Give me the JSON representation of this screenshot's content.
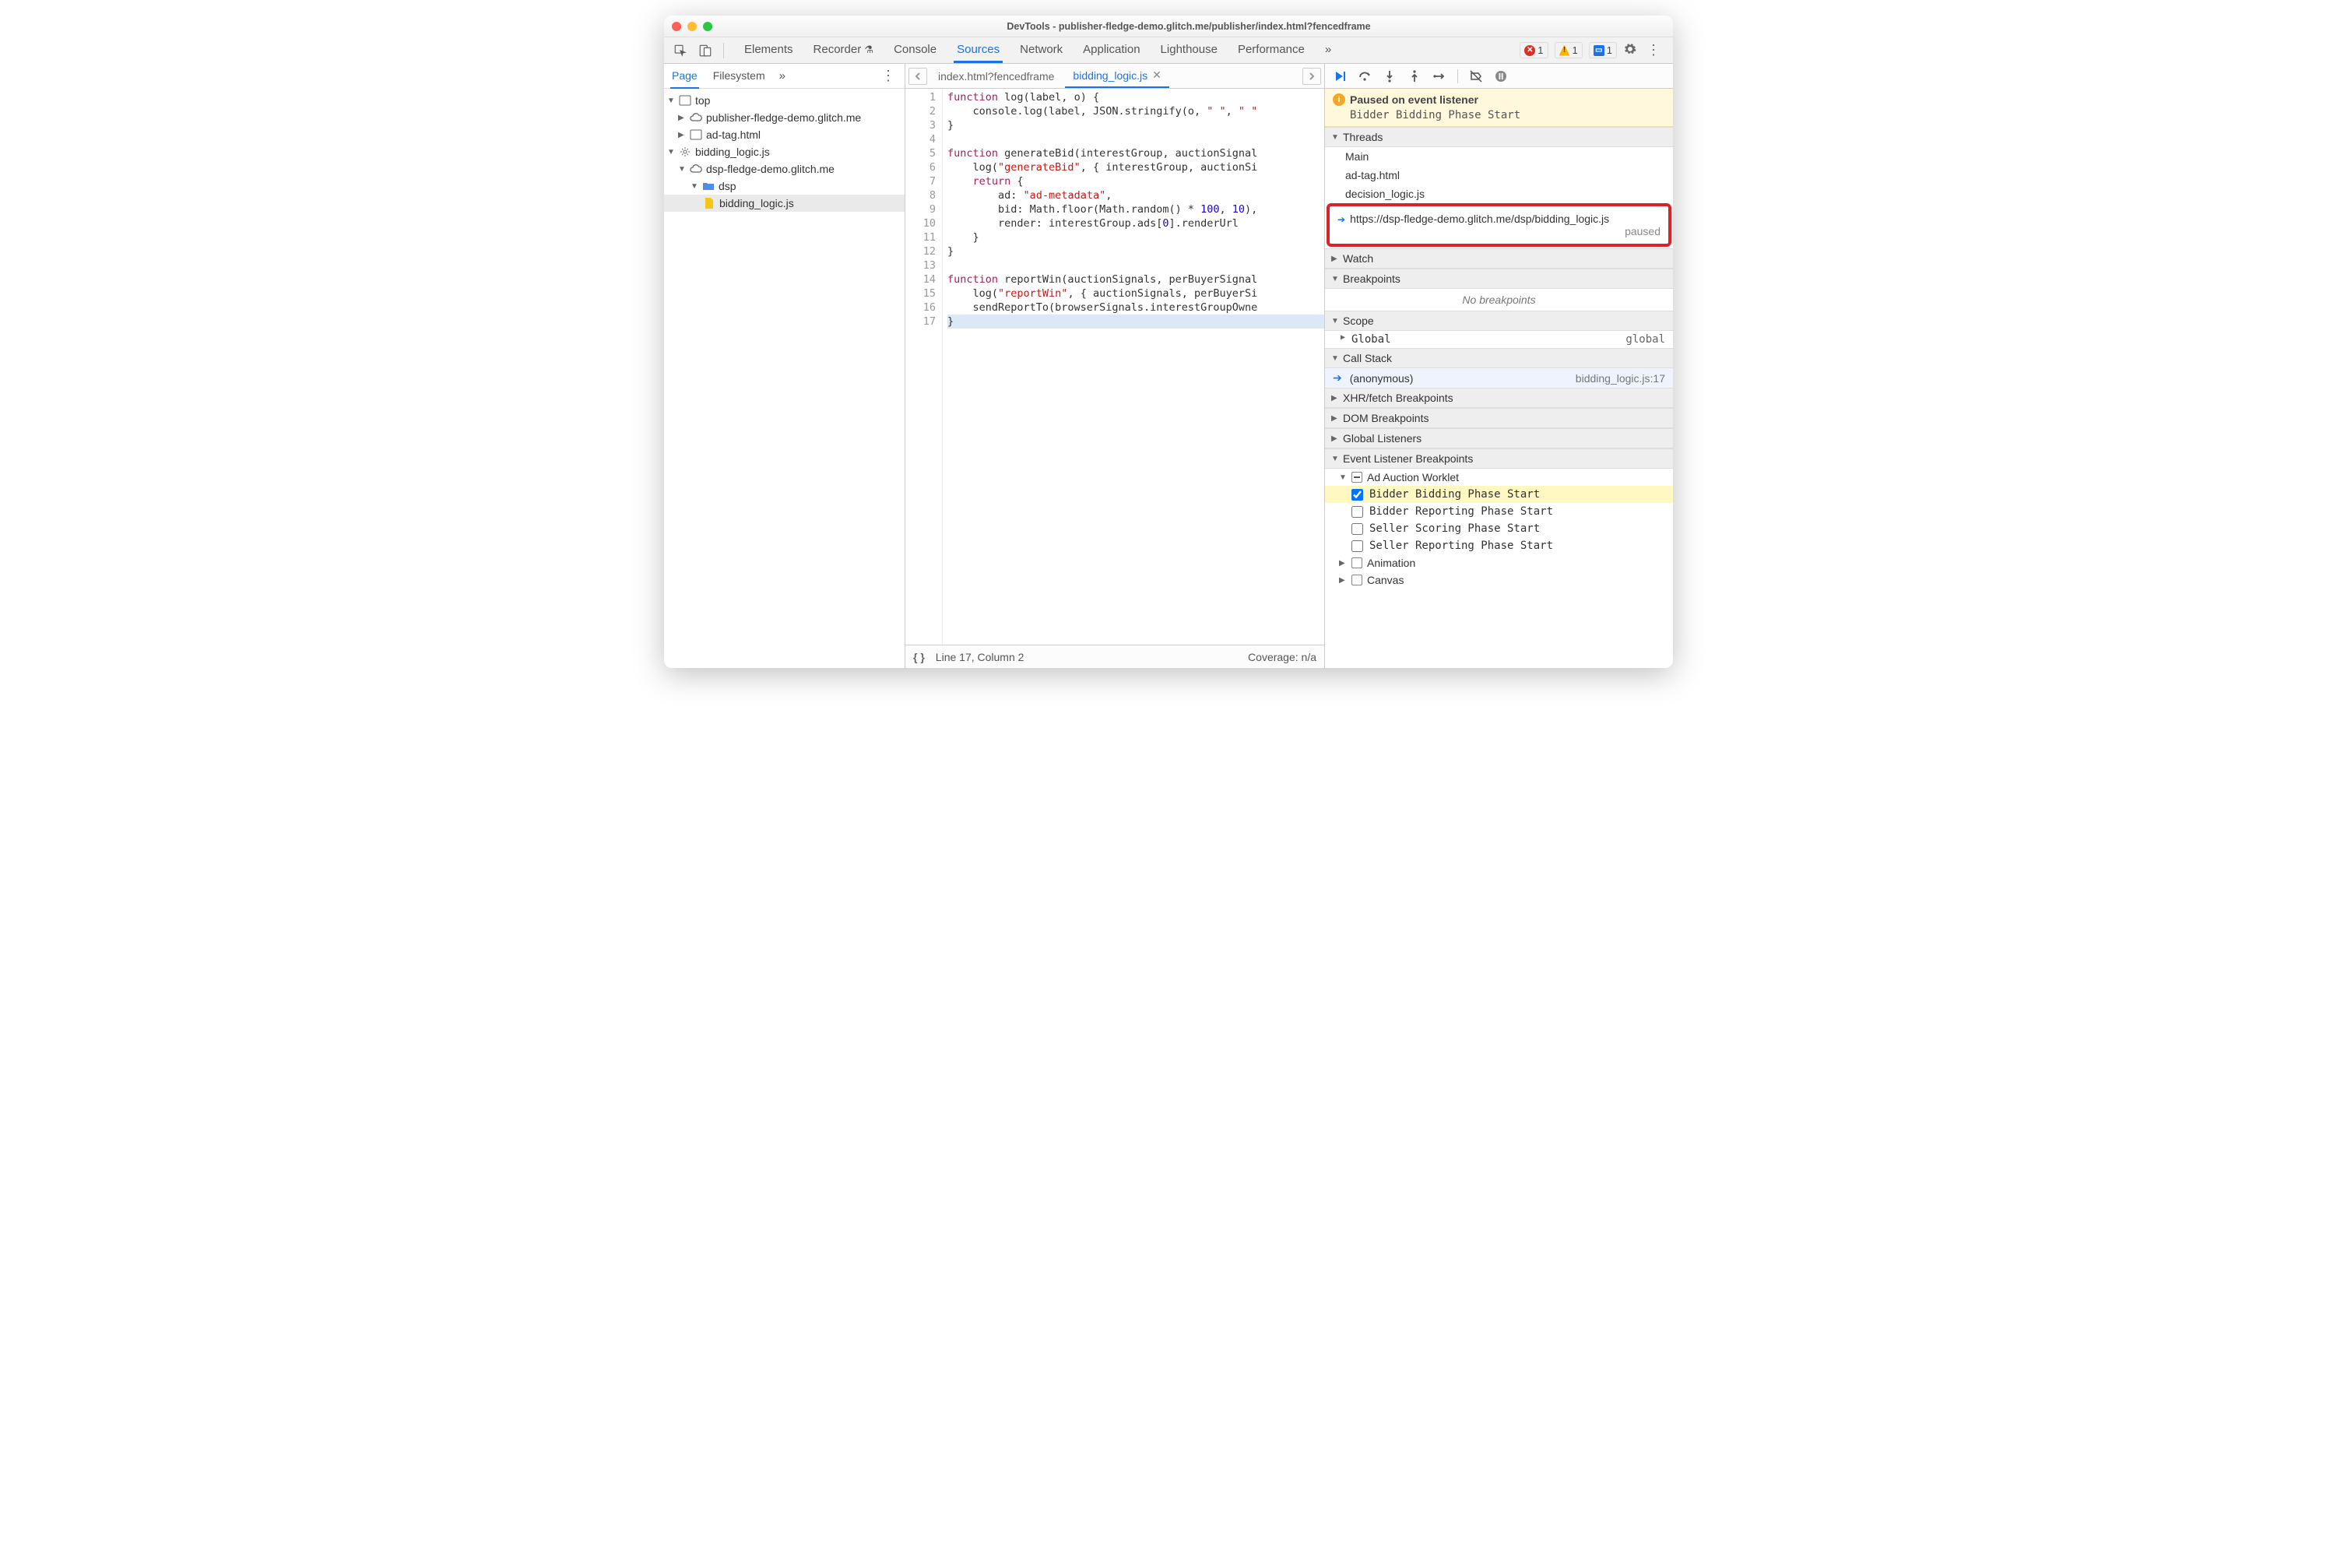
{
  "window_title": "DevTools - publisher-fledge-demo.glitch.me/publisher/index.html?fencedframe",
  "main_tabs": [
    "Elements",
    "Recorder",
    "Console",
    "Sources",
    "Network",
    "Application",
    "Lighthouse",
    "Performance"
  ],
  "main_tab_active": "Sources",
  "badges": {
    "errors": "1",
    "warnings": "1",
    "issues": "1"
  },
  "left_subtabs": {
    "active": "Page",
    "items": [
      "Page",
      "Filesystem"
    ]
  },
  "tree": {
    "top": "top",
    "site1": "publisher-fledge-demo.glitch.me",
    "adtag": "ad-tag.html",
    "bidding_exec": "bidding_logic.js",
    "dsp_site": "dsp-fledge-demo.glitch.me",
    "dsp_folder": "dsp",
    "bidding_file": "bidding_logic.js"
  },
  "editor_tabs": {
    "inactive": "index.html?fencedframe",
    "active": "bidding_logic.js"
  },
  "code_lines": [
    {
      "n": 1,
      "html": "<span class='kw'>function</span> log(label, o) {"
    },
    {
      "n": 2,
      "html": "    console.log(label, JSON.stringify(o, <span class='str'>\" \"</span>, <span class='str'>\" \"</span>"
    },
    {
      "n": 3,
      "html": "}"
    },
    {
      "n": 4,
      "html": ""
    },
    {
      "n": 5,
      "html": "<span class='kw'>function</span> generateBid(interestGroup, auctionSignal"
    },
    {
      "n": 6,
      "html": "    log(<span class='str'>\"generateBid\"</span>, { interestGroup, auctionSi"
    },
    {
      "n": 7,
      "html": "    <span class='kw'>return</span> {"
    },
    {
      "n": 8,
      "html": "        ad: <span class='str'>\"ad-metadata\"</span>,"
    },
    {
      "n": 9,
      "html": "        bid: Math.floor(Math.random() * <span class='num'>100</span>, <span class='num'>10</span>),"
    },
    {
      "n": 10,
      "html": "        render: interestGroup.ads[<span class='num'>0</span>].renderUrl"
    },
    {
      "n": 11,
      "html": "    }"
    },
    {
      "n": 12,
      "html": "}"
    },
    {
      "n": 13,
      "html": ""
    },
    {
      "n": 14,
      "html": "<span class='kw'>function</span> reportWin(auctionSignals, perBuyerSignal"
    },
    {
      "n": 15,
      "html": "    log(<span class='str'>\"reportWin\"</span>, { auctionSignals, perBuyerSi"
    },
    {
      "n": 16,
      "html": "    sendReportTo(browserSignals.interestGroupOwne"
    },
    {
      "n": 17,
      "html": "}",
      "hl": true
    }
  ],
  "status": {
    "line": "Line 17, Column 2",
    "coverage": "Coverage: n/a"
  },
  "paused": {
    "title": "Paused on event listener",
    "reason": "Bidder Bidding Phase Start"
  },
  "threads": {
    "header": "Threads",
    "items": [
      "Main",
      "ad-tag.html",
      "decision_logic.js"
    ],
    "active": {
      "url": "https://dsp-fledge-demo.glitch.me/dsp/bidding_logic.js",
      "status": "paused"
    }
  },
  "sections": {
    "watch": "Watch",
    "breakpoints": "Breakpoints",
    "no_bp": "No breakpoints",
    "scope": "Scope",
    "global_k": "Global",
    "global_v": "global",
    "callstack": "Call Stack",
    "cs_fn": "(anonymous)",
    "cs_loc": "bidding_logic.js:17",
    "xhr": "XHR/fetch Breakpoints",
    "dom": "DOM Breakpoints",
    "gl": "Global Listeners",
    "elb": "Event Listener Breakpoints",
    "cat_ad": "Ad Auction Worklet",
    "ev1": "Bidder Bidding Phase Start",
    "ev2": "Bidder Reporting Phase Start",
    "ev3": "Seller Scoring Phase Start",
    "ev4": "Seller Reporting Phase Start",
    "cat_anim": "Animation",
    "cat_canvas": "Canvas"
  }
}
